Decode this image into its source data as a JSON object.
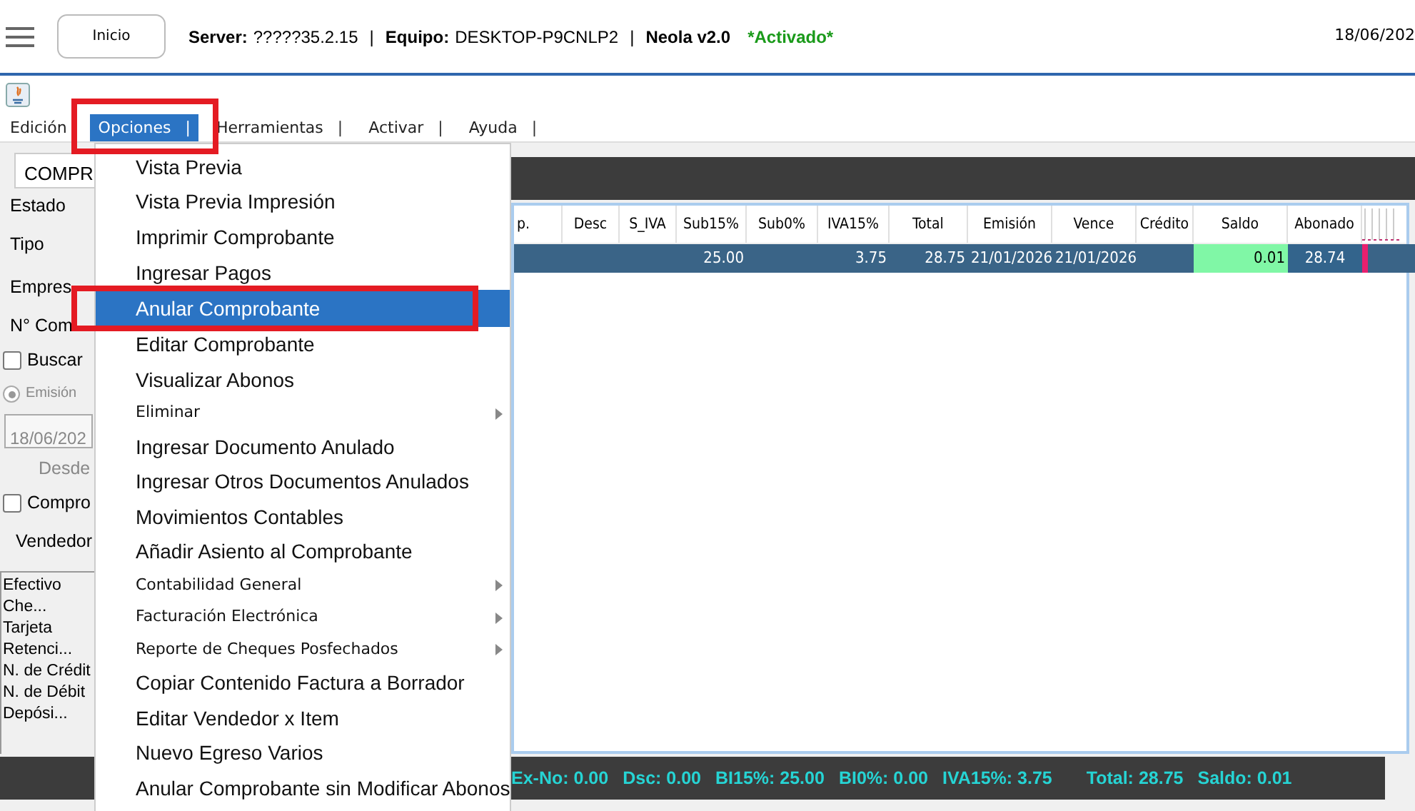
{
  "header": {
    "menu_icon": true,
    "home_button": "Inicio",
    "info": [
      {
        "kind": "label",
        "text": "Server:"
      },
      {
        "kind": "value",
        "text": "?????35.2.15"
      },
      {
        "kind": "sep",
        "text": "|"
      },
      {
        "kind": "label",
        "text": "Equipo:"
      },
      {
        "kind": "value",
        "text": "DESKTOP-P9CNLP2"
      },
      {
        "kind": "sep",
        "text": "|"
      },
      {
        "kind": "label",
        "text": "Neola v2.0"
      },
      {
        "kind": "status",
        "text": "*Activado*"
      }
    ],
    "date": "18/06/202"
  },
  "menubar": [
    {
      "label": "Edición",
      "selected": false,
      "highlighted": false
    },
    {
      "label": "Opciones",
      "separator": "|",
      "selected": true,
      "highlighted": true
    },
    {
      "label": "Herramientas",
      "separator": "|",
      "selected": false,
      "highlighted": false
    },
    {
      "label": "Activar",
      "separator": "|",
      "selected": false,
      "highlighted": false
    },
    {
      "label": "Ayuda",
      "separator": "|",
      "selected": false,
      "highlighted": false
    }
  ],
  "left_panel": {
    "document_type": "COMPR",
    "rows": [
      {
        "kind": "label",
        "text": "Estado"
      },
      {
        "kind": "label",
        "text": "Tipo"
      },
      {
        "kind": "label",
        "text": "Empres"
      },
      {
        "kind": "label",
        "text": "N° Com"
      },
      {
        "kind": "checkbox",
        "text": "Buscar",
        "checked": false
      },
      {
        "kind": "radio",
        "text": "Emisión",
        "selected": true,
        "disabled": true
      },
      {
        "kind": "date",
        "value": "18/06/202",
        "disabled": true
      },
      {
        "kind": "caption",
        "text": "Desde"
      },
      {
        "kind": "checkbox",
        "text": "Compro",
        "checked": false
      },
      {
        "kind": "field",
        "text": "Vendedor"
      }
    ],
    "payments": [
      "Efectivo",
      "Che...",
      "Tarjeta",
      "Retenci...",
      "N. de Crédit",
      "N. de Débit",
      "Depósi..."
    ]
  },
  "context_menu": [
    {
      "kind": "main",
      "label": "Vista Previa",
      "selected": false,
      "highlighted": false
    },
    {
      "kind": "main",
      "label": "Vista Previa Impresión",
      "selected": false,
      "highlighted": false
    },
    {
      "kind": "main",
      "label": "Imprimir Comprobante",
      "selected": false,
      "highlighted": false
    },
    {
      "kind": "main",
      "label": "Ingresar Pagos",
      "selected": false,
      "highlighted": false
    },
    {
      "kind": "main",
      "label": "Anular Comprobante",
      "selected": true,
      "highlighted": true
    },
    {
      "kind": "main",
      "label": "Editar Comprobante",
      "selected": false,
      "highlighted": false
    },
    {
      "kind": "main",
      "label": "Visualizar Abonos",
      "selected": false,
      "highlighted": false
    },
    {
      "kind": "submenu",
      "label": "Eliminar",
      "selected": false,
      "highlighted": false
    },
    {
      "kind": "main",
      "label": "Ingresar Documento Anulado",
      "selected": false,
      "highlighted": false
    },
    {
      "kind": "main",
      "label": "Ingresar Otros Documentos Anulados",
      "selected": false,
      "highlighted": false
    },
    {
      "kind": "main",
      "label": "Movimientos Contables",
      "selected": false,
      "highlighted": false
    },
    {
      "kind": "main",
      "label": "Añadir Asiento al Comprobante",
      "selected": false,
      "highlighted": false
    },
    {
      "kind": "submenu",
      "label": "Contabilidad General",
      "selected": false,
      "highlighted": false
    },
    {
      "kind": "submenu",
      "label": "Facturación Electrónica",
      "selected": false,
      "highlighted": false
    },
    {
      "kind": "submenu",
      "label": "Reporte de Cheques Posfechados",
      "selected": false,
      "highlighted": false
    },
    {
      "kind": "main",
      "label": "Copiar Contenido Factura a Borrador",
      "selected": false,
      "highlighted": false
    },
    {
      "kind": "main",
      "label": "Editar Vendedor x Item",
      "selected": false,
      "highlighted": false
    },
    {
      "kind": "main",
      "label": "Nuevo Egreso Varios",
      "selected": false,
      "highlighted": false
    },
    {
      "kind": "main",
      "label": "Anular Comprobante sin Modificar Abonos",
      "selected": false,
      "highlighted": false
    }
  ],
  "table": {
    "columns": [
      {
        "label": "p."
      },
      {
        "label": "Desc"
      },
      {
        "label": "S_IVA"
      },
      {
        "label": "Sub15%"
      },
      {
        "label": "Sub0%"
      },
      {
        "label": "IVA15%"
      },
      {
        "label": "Total"
      },
      {
        "label": "Emisión"
      },
      {
        "label": "Vence"
      },
      {
        "label": "Crédito"
      },
      {
        "label": "Saldo",
        "color": "#80f7a6"
      },
      {
        "label": "Abonado",
        "color": "#33648c"
      }
    ],
    "rows": [
      {
        "selected": true,
        "cells": [
          null,
          null,
          null,
          "25.00",
          null,
          "3.75",
          "28.75",
          "21/01/2026",
          "21/01/2026",
          null,
          "0.01",
          "28.74"
        ]
      }
    ]
  },
  "totals": [
    "Ex-No: 0.00",
    "Dsc: 0.00",
    "BI15%: 25.00",
    "BI0%: 0.00",
    "IVA15%: 3.75",
    "Total: 28.75",
    "Saldo: 0.01"
  ]
}
